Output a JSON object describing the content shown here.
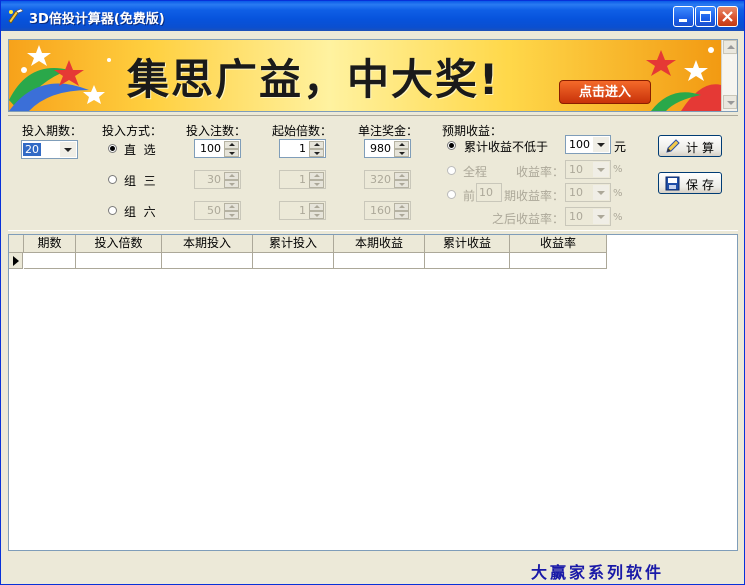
{
  "window": {
    "title": "3D倍投计算器(免费版)"
  },
  "banner": {
    "headline": "集思广益，中大奖!",
    "cta": "点击进入"
  },
  "form": {
    "periods": {
      "label": "投入期数：",
      "value": "20"
    },
    "mode": {
      "label": "投入方式：",
      "options": [
        {
          "label": "直  选",
          "checked": true
        },
        {
          "label": "组  三",
          "checked": false
        },
        {
          "label": "组  六",
          "checked": false
        }
      ]
    },
    "bets": {
      "label": "投入注数：",
      "values": [
        "100",
        "30",
        "50"
      ]
    },
    "start_multiple": {
      "label": "起始倍数：",
      "values": [
        "1",
        "1",
        "1"
      ]
    },
    "prize": {
      "label": "单注奖金：",
      "values": [
        "980",
        "320",
        "160"
      ]
    },
    "expected": {
      "label": "预期收益：",
      "opt1": {
        "label": "累计收益不低于",
        "value": "100",
        "unit": "元",
        "checked": true
      },
      "opt2": {
        "label": "全程",
        "rate_label": "收益率：",
        "value": "10",
        "unit": "%"
      },
      "opt3": {
        "label": "前",
        "periods": "10",
        "rate_label": "期收益率：",
        "value": "10",
        "unit": "%"
      },
      "after": {
        "label": "之后收益率：",
        "value": "10",
        "unit": "%"
      }
    }
  },
  "buttons": {
    "calc": "计算",
    "save": "保存"
  },
  "table": {
    "headers": [
      "期数",
      "投入倍数",
      "本期投入",
      "累计投入",
      "本期收益",
      "累计收益",
      "收益率"
    ]
  },
  "footer": "大赢家系列软件",
  "colors": {
    "titlebar": "#0a5ae8",
    "window_bg": "#ece9d8",
    "footer_text": "#1a1aa8"
  }
}
